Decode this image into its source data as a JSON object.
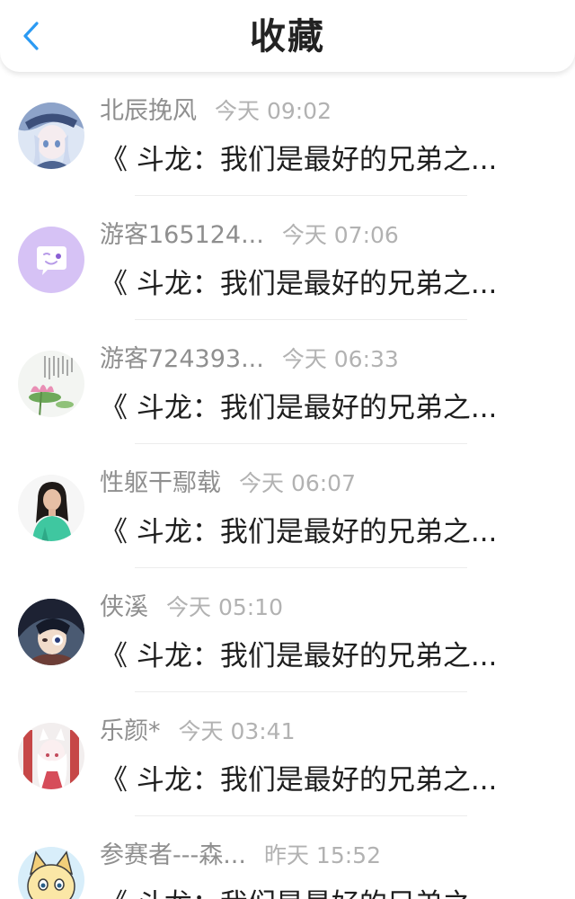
{
  "header": {
    "title": "收藏",
    "back_icon": "chevron-left-icon",
    "accent": "#2b9af3"
  },
  "items": [
    {
      "user": "北辰挽风",
      "time": "今天 09:02",
      "title": "《 斗龙：我们是最好的兄弟之...",
      "avatar": "anime-girl-cap"
    },
    {
      "user": "游客165124...",
      "time": "今天 07:06",
      "title": "《 斗龙：我们是最好的兄弟之...",
      "avatar": "default-chat-bubble"
    },
    {
      "user": "游客724393...",
      "time": "今天 06:33",
      "title": "《 斗龙：我们是最好的兄弟之...",
      "avatar": "lotus-poem"
    },
    {
      "user": "性躯干鄢载",
      "time": "今天 06:07",
      "title": "《 斗龙：我们是最好的兄弟之...",
      "avatar": "girl-green-shirt"
    },
    {
      "user": "侠溪",
      "time": "今天 05:10",
      "title": "《 斗龙：我们是最好的兄弟之...",
      "avatar": "dark-anime-boy"
    },
    {
      "user": "乐颜*",
      "time": "今天 03:41",
      "title": "《 斗龙：我们是最好的兄弟之...",
      "avatar": "white-fox-girl"
    },
    {
      "user": "参赛者---森...",
      "time": "昨天 15:52",
      "title": "《 斗龙：我们是最好的兄弟之...",
      "avatar": "cartoon-cat"
    }
  ]
}
